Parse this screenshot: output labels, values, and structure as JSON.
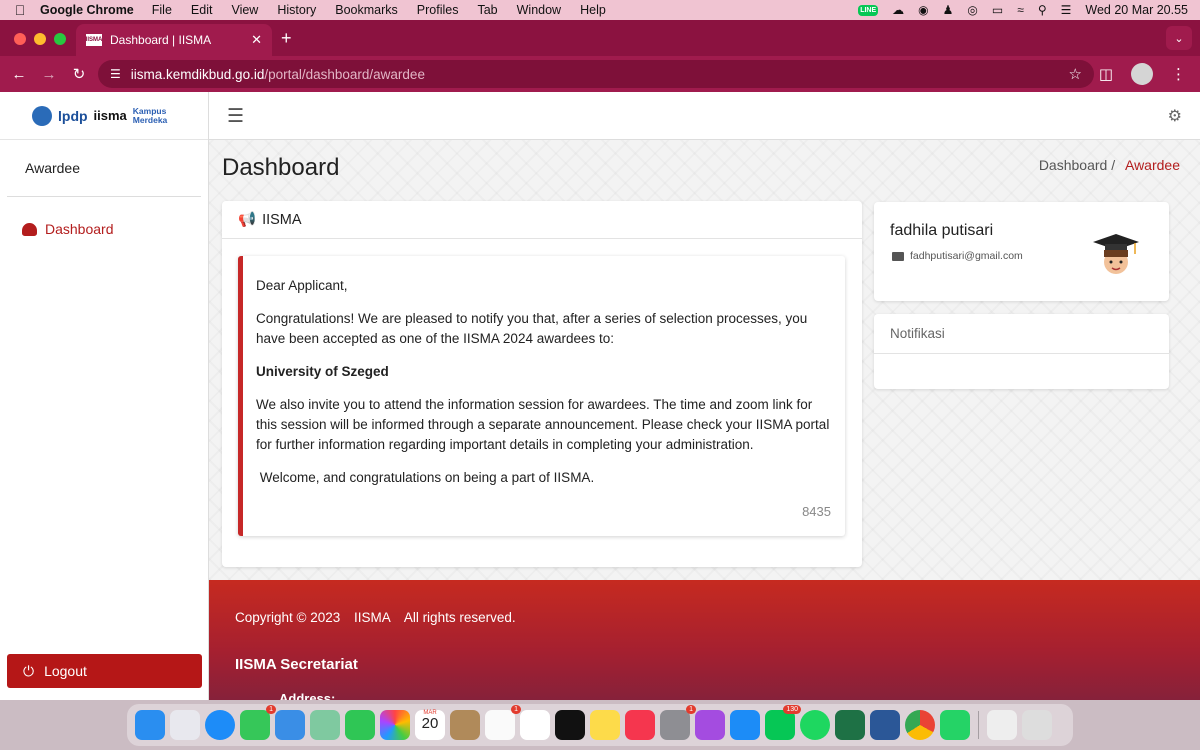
{
  "menubar": {
    "app_name": "Google Chrome",
    "items": [
      "File",
      "Edit",
      "View",
      "History",
      "Bookmarks",
      "Profiles",
      "Tab",
      "Window",
      "Help"
    ],
    "line_badge": "LINE",
    "datetime": "Wed 20 Mar  20.55"
  },
  "browser": {
    "tab_title": "Dashboard | IISMA",
    "favicon_text": "IISMA",
    "url_host": "iisma.kemdikbud.go.id",
    "url_path": "/portal/dashboard/awardee"
  },
  "sidebar": {
    "logos": {
      "lpdp": "lpdp",
      "iisma": "iisma",
      "kampus_merdeka_1": "Kampus",
      "kampus_merdeka_2": "Merdeka"
    },
    "user_role": "Awardee",
    "nav_dashboard": "Dashboard",
    "logout": "Logout"
  },
  "header": {
    "page_title": "Dashboard",
    "breadcrumb_home": "Dashboard /",
    "breadcrumb_active": "Awardee"
  },
  "announcement": {
    "card_title": "IISMA",
    "greeting": "Dear Applicant,",
    "para1": "Congratulations! We are pleased to notify you that, after a series of selection processes, you have been accepted as one of the IISMA 2024 awardees to:",
    "university": "University of Szeged",
    "para2": "We also invite you to attend the information session for awardees. The time and zoom link for this session will be informed through a separate announcement. Please check your IISMA portal for further information regarding important details in completing your administration.",
    "closing": " Welcome, and congratulations on being a part of IISMA.",
    "code": "8435"
  },
  "profile": {
    "name": "fadhila putisari",
    "email": "fadhputisari@gmail.com"
  },
  "notifications": {
    "title": "Notifikasi"
  },
  "footer": {
    "copyright": "Copyright © 2023",
    "brand": "IISMA",
    "rights": "All rights reserved.",
    "secretariat": "IISMA Secretariat",
    "address_label": "Address:"
  },
  "dock": {
    "calendar_month": "MAR",
    "calendar_day": "20",
    "messages_badge": "1",
    "reminders_badge": "1",
    "settings_badge": "1",
    "line_badge": "130"
  },
  "colors": {
    "accent_red": "#b31d1d",
    "chrome_tab": "#8b1240",
    "chrome_toolbar": "#a01b4d"
  }
}
